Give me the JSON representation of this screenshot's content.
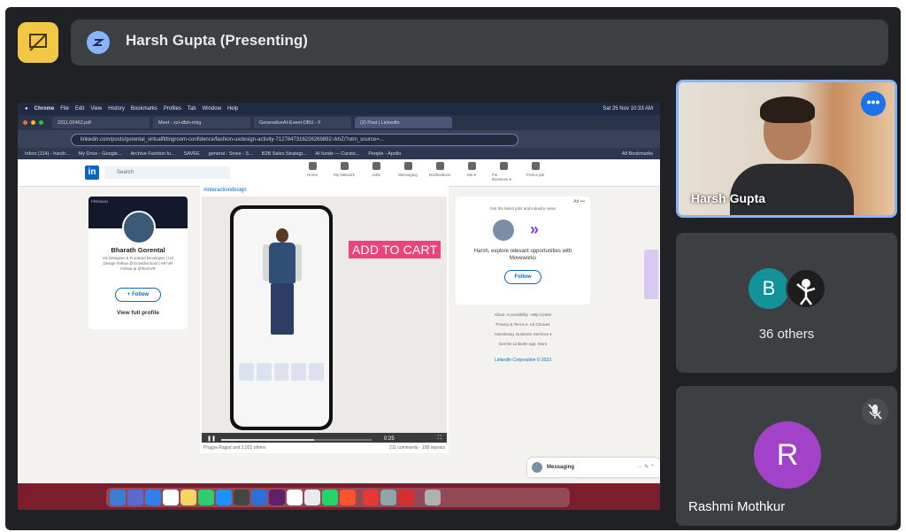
{
  "meet": {
    "presenter_title": "Harsh Gupta (Presenting)",
    "tiles": [
      {
        "name": "Harsh Gupta",
        "more_label": "•••"
      },
      {
        "avatar_letter": "B",
        "label": "36 others"
      },
      {
        "avatar_letter": "R",
        "name": "Rashmi Mothkur"
      }
    ]
  },
  "screen": {
    "menubar": [
      "Chrome",
      "File",
      "Edit",
      "View",
      "History",
      "Bookmarks",
      "Profiles",
      "Tab",
      "Window",
      "Help"
    ],
    "menubar_right": "Sat 25 Nov 10:33 AM",
    "tabs": [
      "2311.02462.pdf",
      "Meet - zxi-dfsh-mkg",
      "GenerativeAI-Event-DBU - F",
      "(2) Post | LinkedIn"
    ],
    "url": "linkedin.com/posts/gorental_virtualfittingroom-confidence/fashion-uxdesign-activity-7127847316226269892-rkhZ/?utm_source=...",
    "bookmarks": [
      "Inbox (114) - harsh...",
      "My Drive - Google...",
      "Archive Fashion fu...",
      "SAVEE",
      "general - Snive - S...",
      "B2B Sales Strategi...",
      "AI funds — Curate...",
      "People - Apollo",
      "All Bookmarks"
    ],
    "linkedin": {
      "search_placeholder": "Search",
      "nav": [
        "Home",
        "My Network",
        "Jobs",
        "Messaging",
        "Notifications",
        "Me ▾",
        "For Business ▾",
        "Post a job"
      ],
      "profile": {
        "banner": "PREMIUM",
        "name": "Bharath Gorental",
        "desc": "UX Designer & Frontend Developer | UX Design Fellow @Growthschool | AR-VR Fellow at @TechVR",
        "follow": "+ Follow",
        "view_full": "View full profile"
      },
      "post": {
        "hashtag": "#interactiondesign",
        "overlay": "ADD TO CART",
        "time": "0:25",
        "progress": 0.62,
        "reactions": "Pragya Rajput and 2,031 others",
        "comments": "211 comments · 108 reposts"
      },
      "ad": {
        "label": "Ad •••",
        "desc": "Get the latest jobs and industry news",
        "text": "Harsh, explore relevant opportunities with Moveworks",
        "follow": "Follow"
      },
      "footer": [
        "About",
        "Accessibility",
        "Help Center",
        "Privacy & Terms ▾",
        "Ad Choices",
        "Advertising",
        "Business Services ▾",
        "Get the LinkedIn app",
        "More"
      ],
      "corp": "LinkedIn Corporation © 2023",
      "messaging": "Messaging"
    }
  }
}
